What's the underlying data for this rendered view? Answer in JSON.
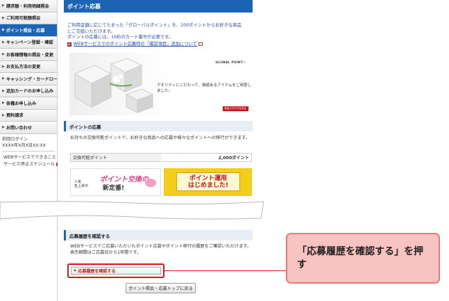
{
  "sidebar": {
    "items": [
      {
        "label": "請求額・利用明細照会",
        "active": false
      },
      {
        "label": "ご利用可能額照会",
        "active": false
      },
      {
        "label": "ポイント照会・応募",
        "active": true
      },
      {
        "label": "キャンペーン登録・確認",
        "active": false
      },
      {
        "label": "お客様情報の照会・変更",
        "active": false
      },
      {
        "label": "お支払方法の変更",
        "active": false
      },
      {
        "label": "キャッシング・カードローン",
        "active": false
      },
      {
        "label": "追加カードのお申し込み",
        "active": false
      },
      {
        "label": "各種お申し込み",
        "active": false
      },
      {
        "label": "資料請求",
        "active": false
      },
      {
        "label": "お問い合わせ",
        "active": false
      }
    ],
    "last_login_label": "前回ログイン",
    "last_login_value": "XXXX年X月X日XX:XX",
    "links": [
      {
        "label": "WEBサービスでできること"
      },
      {
        "label": "サービス停止スケジュール"
      }
    ]
  },
  "main": {
    "title": "ポイント応募",
    "intro_lines": [
      "ご利用金額に応じてたまった「グローバルポイント」を、200ポイントからお好きな商品",
      "にご交換いただけます。",
      "ポイントの応募には、16桁のカード番号が必要です。"
    ],
    "intro_link": "WEBサービスでのポイント応募時の「確認項目」追加について",
    "banner": {
      "logo": "GLOBAL POINT",
      "logo_mark": "+",
      "text": "クオリティにこだわって、価値あるアイテムをご用意しました。",
      "button": "商品カタログを見る"
    },
    "section1_title": "ポイントの応募",
    "section1_desc": "お持ちの交換可能ポイントで、お好きな商品への応募や様々なポイントへの移行ができます。",
    "points_label": "交換可能ポイント",
    "points_value": "2,000ポイント",
    "promo1": {
      "small_1": "人気",
      "small_2": "急上昇中",
      "big": "ポイント交換の",
      "big2": "新定番!"
    },
    "promo2": {
      "line1": "ポイント運用",
      "line2": "はじめました!"
    },
    "section2_title": "応募履歴を確認する",
    "section2_desc": "WEBサービスでご応募いただいたポイント応募やポイント移行の履歴をご確認いただけます。表示期間はご応募日から1年間です。",
    "history_button": "応募履歴を確認する",
    "top_button": "ポイント照会・応募トップに戻る"
  },
  "callout": {
    "text": "「応募履歴を確認する」を押す"
  },
  "colors": {
    "brand_blue": "#1e64b4",
    "highlight_red": "#d9141b",
    "callout_bg": "#f8c3c1"
  }
}
